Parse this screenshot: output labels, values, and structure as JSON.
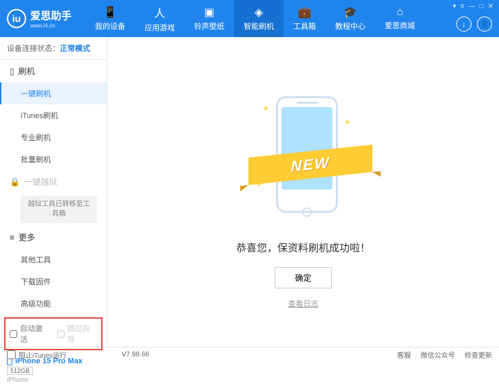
{
  "header": {
    "logo_glyph": "iu",
    "app_name": "爱思助手",
    "app_url": "www.i4.cn",
    "nav": [
      {
        "label": "我的设备"
      },
      {
        "label": "应用游戏"
      },
      {
        "label": "铃声壁纸"
      },
      {
        "label": "智能刷机"
      },
      {
        "label": "工具箱"
      },
      {
        "label": "教程中心"
      },
      {
        "label": "爱思商城"
      }
    ],
    "win_controls": [
      "▾",
      "≡",
      "—",
      "□",
      "✕"
    ]
  },
  "sidebar": {
    "status_label": "设备连接状态：",
    "status_value": "正常模式",
    "section_flash": "刷机",
    "items_flash": [
      "一键刷机",
      "iTunes刷机",
      "专业刷机",
      "批量刷机"
    ],
    "section_jailbreak": "一键越狱",
    "jailbreak_note": "越狱工具已转移至工具箱",
    "section_more": "更多",
    "items_more": [
      "其他工具",
      "下载固件",
      "高级功能"
    ],
    "checkbox1": "自动激活",
    "checkbox2": "跳过向导",
    "device_name": "iPhone 15 Pro Max",
    "device_storage": "512GB",
    "device_type": "iPhone"
  },
  "main": {
    "ribbon": "NEW",
    "success": "恭喜您，保资料刷机成功啦！",
    "confirm": "确定",
    "view_log": "查看日志"
  },
  "footer": {
    "block_itunes": "阻止iTunes运行",
    "version": "V7.98.66",
    "links": [
      "客服",
      "微信公众号",
      "检查更新"
    ]
  }
}
